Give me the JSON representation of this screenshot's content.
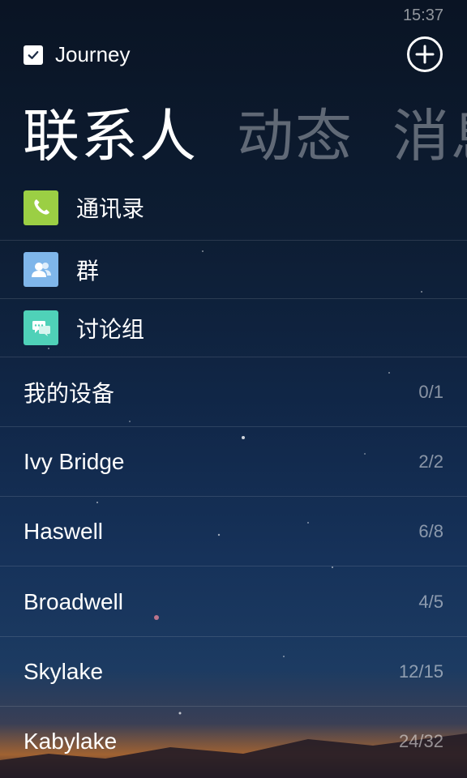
{
  "status": {
    "time": "15:37"
  },
  "header": {
    "title": "Journey"
  },
  "pivot": {
    "tabs": [
      "联系人",
      "动态",
      "消息"
    ]
  },
  "menu": [
    {
      "label": "通讯录",
      "icon": "phone-icon",
      "color": "#9bcf44"
    },
    {
      "label": "群",
      "icon": "group-icon",
      "color": "#7fb6ea"
    },
    {
      "label": "讨论组",
      "icon": "chat-icon",
      "color": "#4fd1b8"
    }
  ],
  "groups": [
    {
      "name": "我的设备",
      "count": "0/1"
    },
    {
      "name": "Ivy Bridge",
      "count": "2/2"
    },
    {
      "name": "Haswell",
      "count": "6/8"
    },
    {
      "name": "Broadwell",
      "count": "4/5"
    },
    {
      "name": "Skylake",
      "count": "12/15"
    },
    {
      "name": "Kabylake",
      "count": "24/32"
    }
  ]
}
